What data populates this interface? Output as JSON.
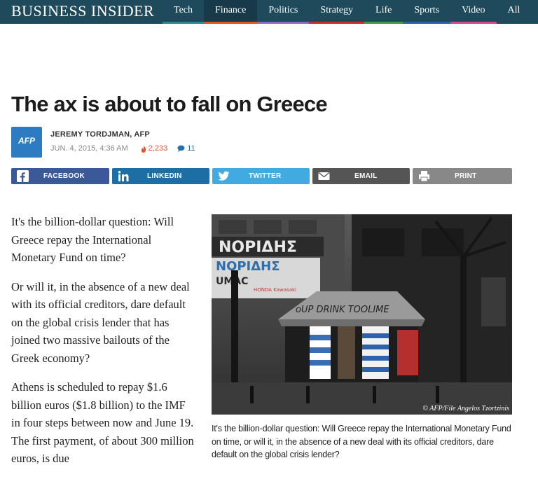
{
  "header": {
    "logo": "BUSINESS INSIDER",
    "nav": [
      {
        "label": "Tech",
        "color": "#2e8a8a",
        "active": false
      },
      {
        "label": "Finance",
        "color": "#e2561a",
        "active": true
      },
      {
        "label": "Politics",
        "color": "#8a6bbf",
        "active": false
      },
      {
        "label": "Strategy",
        "color": "#c9302c",
        "active": false
      },
      {
        "label": "Life",
        "color": "#3d9b4a",
        "active": false
      },
      {
        "label": "Sports",
        "color": "#2f5fa8",
        "active": false
      },
      {
        "label": "Video",
        "color": "#d24a8b",
        "active": false
      },
      {
        "label": "All",
        "color": "#1e4a5c",
        "active": false
      }
    ]
  },
  "article": {
    "title": "The ax is about to fall on Greece",
    "source_logo": "AFP",
    "author": "JEREMY TORDJMAN, AFP",
    "date": "JUN. 4, 2015, 4:36 AM",
    "views": "2,233",
    "comments": "11",
    "share": {
      "facebook": "FACEBOOK",
      "linkedin": "LINKEDIN",
      "twitter": "TWITTER",
      "email": "EMAIL",
      "print": "PRINT"
    },
    "paragraphs": [
      "It's the billion-dollar question: Will Greece repay the International Monetary Fund on time?",
      "Or will it, in the absence of a new deal with its official creditors, dare default on the global crisis lender that has joined two massive bailouts of the Greek economy?",
      "Athens is scheduled to repay $1.6 billion euros ($1.8 billion) to the IMF in four steps between now and June 19. The first payment, of about 300 million euros, is due"
    ],
    "image": {
      "credit": "© AFP/File Angelos Tzortzinis",
      "caption": "It's the billion-dollar question: Will Greece repay the International Monetary Fund on time, or will it, in the absence of a new deal with its official creditors, dare default on the global crisis lender?"
    }
  },
  "colors": {
    "nav_bg": "#1e4a5c",
    "facebook": "#3b5998",
    "linkedin": "#1c6ea4",
    "twitter": "#41abe1",
    "email": "#555555",
    "print": "#888888"
  }
}
